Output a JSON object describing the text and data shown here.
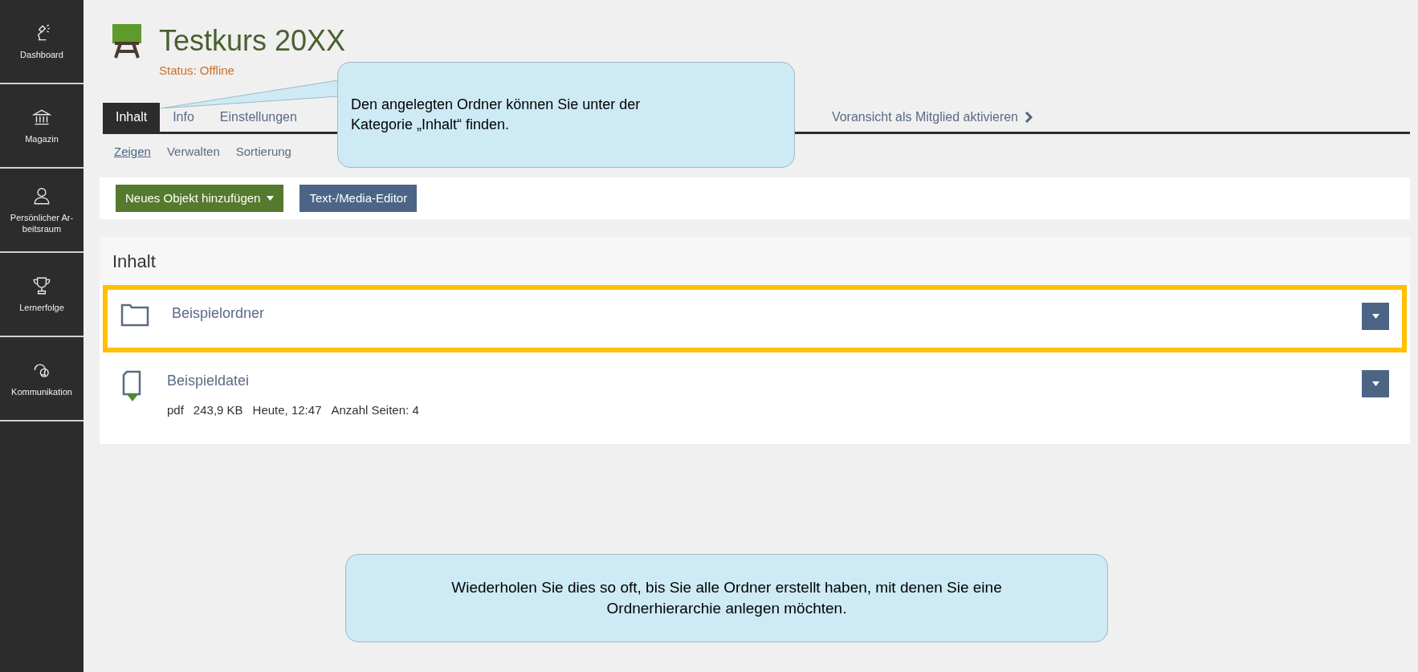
{
  "sidebar": {
    "items": [
      {
        "label": "Dashboard"
      },
      {
        "label": "Magazin"
      },
      {
        "label": "Persönlicher Ar-beitsraum"
      },
      {
        "label": "Lernerfolge"
      },
      {
        "label": "Kommunikation"
      }
    ]
  },
  "header": {
    "title": "Testkurs 20XX",
    "status": "Status: Offline"
  },
  "tabs": [
    {
      "label": "Inhalt",
      "selected": true
    },
    {
      "label": "Info",
      "selected": false
    },
    {
      "label": "Einstellungen",
      "selected": false
    }
  ],
  "preview_link": "Voransicht als Mitglied aktivieren",
  "subtabs": [
    {
      "label": "Zeigen",
      "selected": true
    },
    {
      "label": "Verwalten",
      "selected": false
    },
    {
      "label": "Sortierung",
      "selected": false
    }
  ],
  "toolbar": {
    "add_button": "Neues Objekt hinzufügen",
    "editor_button": "Text-/Media-Editor"
  },
  "content": {
    "heading": "Inhalt",
    "items": [
      {
        "kind": "folder",
        "title": "Beispielordner",
        "highlighted": true
      },
      {
        "kind": "file",
        "title": "Beispieldatei",
        "highlighted": false,
        "properties": [
          "pdf",
          "243,9 KB",
          "Heute, 12:47",
          "Anzahl Seiten: 4"
        ]
      }
    ]
  },
  "callouts": [
    {
      "text": "Den angelegten Ordner können Sie unter der Kategorie „Inhalt“ finden."
    },
    {
      "text": "Wiederholen Sie dies so oft, bis Sie alle Ordner erstellt haben, mit denen Sie eine Ordnerhierarchie anlegen möchten."
    }
  ]
}
